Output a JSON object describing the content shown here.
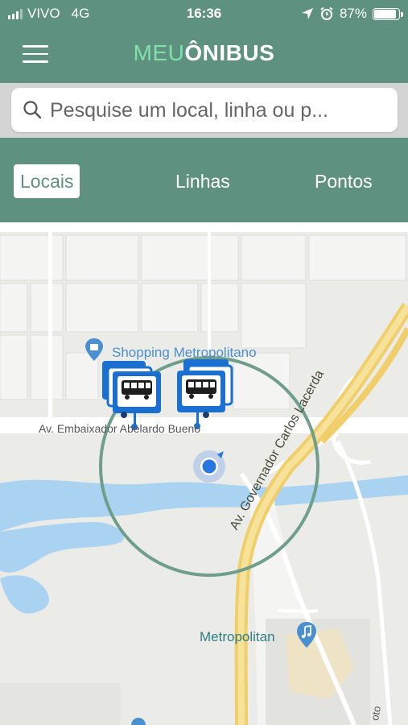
{
  "status": {
    "carrier": "VIVO",
    "network": "4G",
    "time": "16:36",
    "battery": "87%",
    "battery_level": 0.87
  },
  "header": {
    "logo_part1": "MEU",
    "logo_part2": "ÔNIBUS"
  },
  "search": {
    "placeholder": "Pesquise um local, linha ou p..."
  },
  "tabs": [
    {
      "label": "Locais",
      "active": true
    },
    {
      "label": "Linhas"
    },
    {
      "label": "Pontos"
    }
  ],
  "map": {
    "labels": {
      "shopping": "Shopping Metropolitano",
      "avenue1": "Av. Embaixador Abelardo Bueno",
      "avenue2": "Av. Governador Carlos Lacerda",
      "venue": "Metropolitan",
      "partial": "oto"
    }
  },
  "colors": {
    "brand": "#5e9180",
    "logo_accent": "#7ee2a9",
    "bus_marker": "#1b6fd0",
    "poi": "#4a8fcf"
  }
}
